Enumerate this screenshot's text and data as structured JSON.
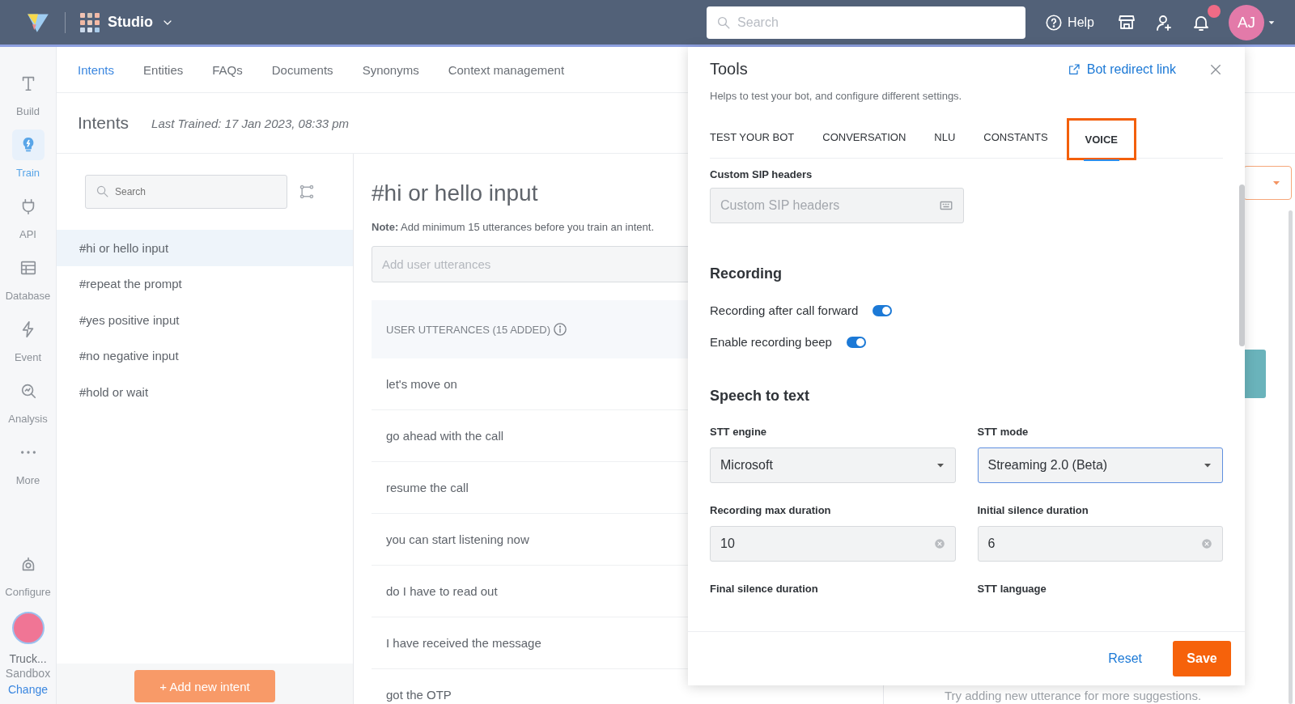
{
  "topbar": {
    "app_name": "Studio",
    "search": {
      "placeholder": "Search"
    },
    "help": "Help",
    "avatar": "AJ",
    "notification_dot": true
  },
  "sidebar": {
    "items": [
      {
        "label": "Build",
        "selected": false
      },
      {
        "label": "Train",
        "selected": true
      },
      {
        "label": "API",
        "selected": false
      },
      {
        "label": "Database",
        "selected": false
      },
      {
        "label": "Event",
        "selected": false
      },
      {
        "label": "Analysis",
        "selected": false
      },
      {
        "label": "More",
        "selected": false
      },
      {
        "label": "Configure",
        "selected": false
      }
    ],
    "bot": {
      "name": "Truck...",
      "environment": "Sandbox",
      "change_link": "Change"
    }
  },
  "tabs": [
    {
      "label": "Intents",
      "selected": true
    },
    {
      "label": "Entities",
      "selected": false
    },
    {
      "label": "FAQs",
      "selected": false
    },
    {
      "label": "Documents",
      "selected": false
    },
    {
      "label": "Synonyms",
      "selected": false
    },
    {
      "label": "Context management",
      "selected": false
    }
  ],
  "header": {
    "title": "Intents",
    "last_trained": "Last Trained: 17 Jan 2023, 08:33 pm"
  },
  "intents": {
    "search": {
      "placeholder": "Search"
    },
    "items": [
      {
        "label": "#hi or hello input",
        "selected": true
      },
      {
        "label": "#repeat the prompt",
        "selected": false
      },
      {
        "label": "#yes positive input",
        "selected": false
      },
      {
        "label": "#no negative input",
        "selected": false
      },
      {
        "label": "#hold or wait",
        "selected": false
      }
    ],
    "add_button": "+ Add new intent"
  },
  "intent_detail": {
    "title": "#hi or hello input",
    "note": "**Note:** Add minimum 15 utterances before you train an intent.",
    "input": {
      "placeholder": "Add user utterances"
    },
    "list_header": "USER UTTERANCES (15 ADDED)",
    "utterances": [
      "let's move on",
      "go ahead with the call",
      "resume the call",
      "you can start listening now",
      "do I have to read out",
      "I have received the message",
      "got the OTP"
    ],
    "suggestion_hint": "Try adding new utterance for more suggestions."
  },
  "tools": {
    "title": "Tools",
    "link": "Bot redirect link",
    "subtitle": "Helps to test your bot, and configure different settings.",
    "tabs": [
      {
        "label": "TEST YOUR BOT",
        "selected": false
      },
      {
        "label": "CONVERSATION",
        "selected": false
      },
      {
        "label": "NLU",
        "selected": false
      },
      {
        "label": "CONSTANTS",
        "selected": false
      },
      {
        "label": "VOICE",
        "selected": true
      }
    ],
    "sip_headers": {
      "label": "Custom SIP headers",
      "placeholder": "Custom SIP headers"
    },
    "recording": {
      "heading": "Recording",
      "toggles": [
        {
          "label": "Recording after call forward",
          "on": true
        },
        {
          "label": "Enable recording beep",
          "on": true
        }
      ]
    },
    "speech_to_text": {
      "heading": "Speech to text",
      "fields": [
        {
          "kind": "select",
          "label": "STT engine",
          "value": "Microsoft",
          "focused": false
        },
        {
          "kind": "select",
          "label": "STT mode",
          "value": "Streaming 2.0 (Beta)",
          "focused": true
        },
        {
          "kind": "number",
          "label": "Recording max duration",
          "value": "10",
          "focused": false
        },
        {
          "kind": "number",
          "label": "Initial silence duration",
          "value": "6",
          "focused": false
        },
        {
          "kind": "label",
          "label": "Final silence duration"
        },
        {
          "kind": "label",
          "label": "STT language"
        }
      ]
    },
    "buttons": {
      "reset": "Reset",
      "save": "Save"
    }
  }
}
